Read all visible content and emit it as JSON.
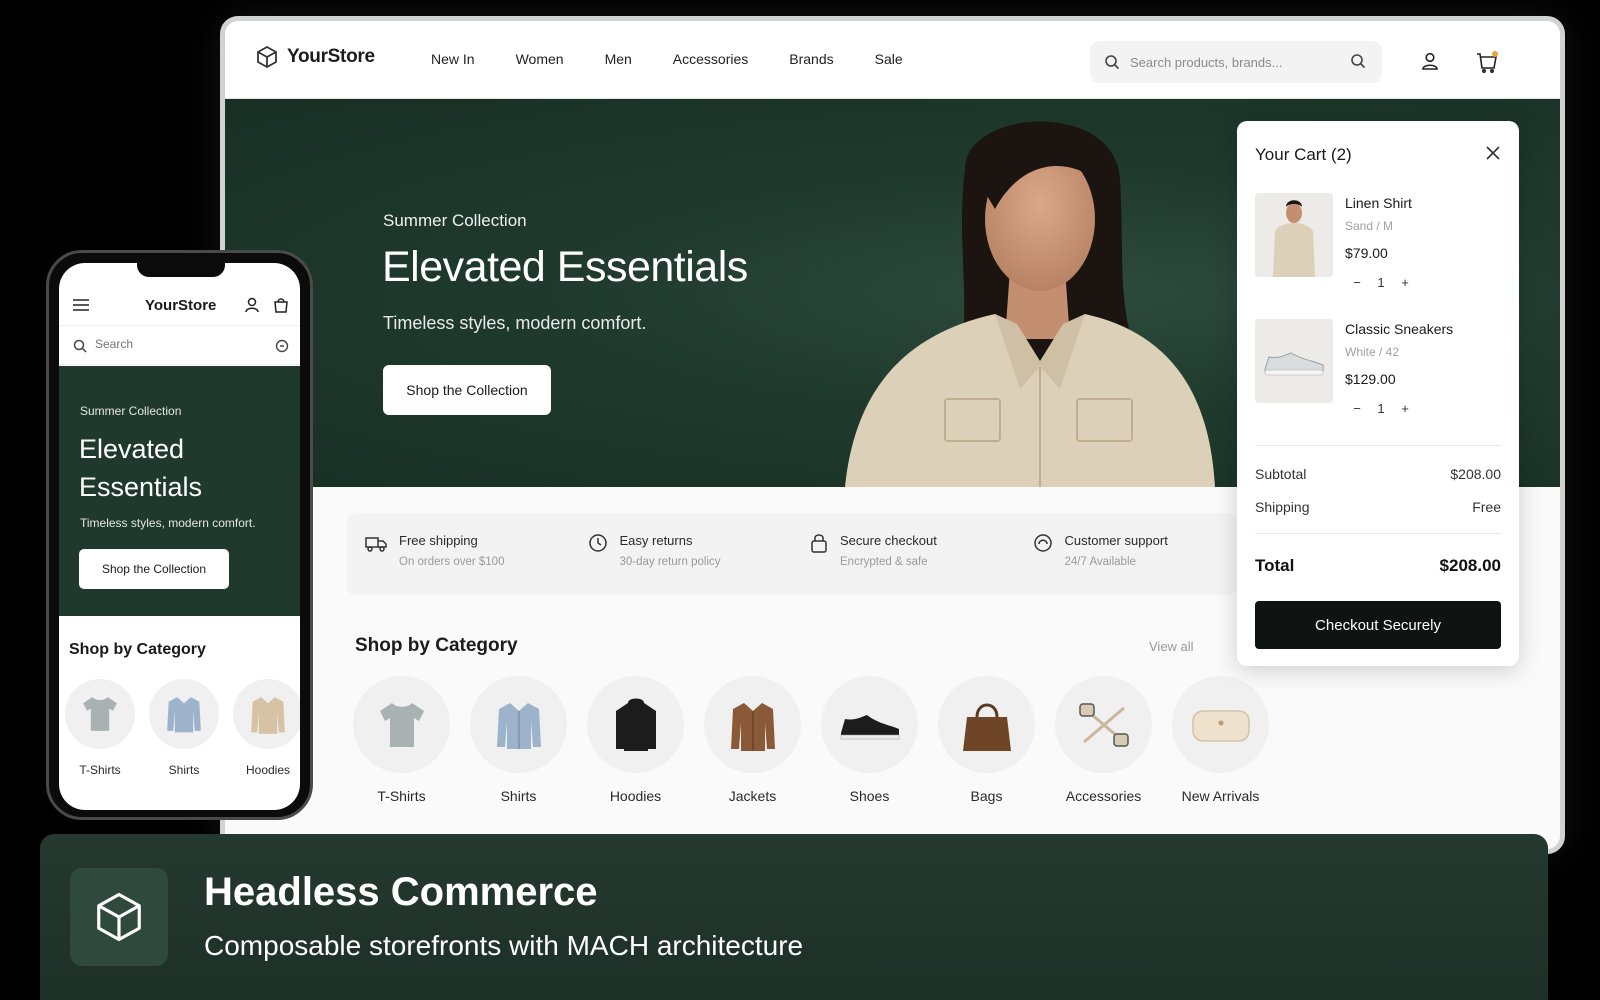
{
  "store": {
    "name": "YourStore"
  },
  "nav": {
    "items": [
      "New In",
      "Women",
      "Men",
      "Accessories",
      "Brands",
      "Sale"
    ],
    "search_placeholder": "Search products, brands..."
  },
  "hero": {
    "eyebrow": "Summer Collection",
    "title": "Elevated Essentials",
    "subtitle": "Timeless styles, modern comfort.",
    "cta": "Shop the Collection"
  },
  "features": [
    {
      "title": "Free shipping",
      "sub": "On orders over $100",
      "icon": "truck-icon"
    },
    {
      "title": "Easy returns",
      "sub": "30-day return policy",
      "icon": "return-icon"
    },
    {
      "title": "Secure checkout",
      "sub": "Encrypted & safe",
      "icon": "lock-icon"
    },
    {
      "title": "Customer support",
      "sub": "24/7 Available",
      "icon": "support-icon"
    }
  ],
  "categories": {
    "title": "Shop by Category",
    "view_all": "View all",
    "items": [
      "T-Shirts",
      "Shirts",
      "Hoodies",
      "Jackets",
      "Shoes",
      "Bags",
      "Accessories",
      "New Arrivals"
    ]
  },
  "cart": {
    "title": "Your Cart (2)",
    "items": [
      {
        "name": "Linen Shirt",
        "variant": "Sand / M",
        "price": "$79.00",
        "qty": "1"
      },
      {
        "name": "Classic Sneakers",
        "variant": "White / 42",
        "price": "$129.00",
        "qty": "1"
      }
    ],
    "subtotal_label": "Subtotal",
    "subtotal": "$208.00",
    "shipping_label": "Shipping",
    "shipping": "Free",
    "total_label": "Total",
    "total": "$208.00",
    "checkout": "Checkout Securely"
  },
  "mobile": {
    "search_placeholder": "Search",
    "hero_eyebrow": "Summer Collection",
    "hero_title": "Elevated Essentials",
    "hero_sub": "Timeless styles, modern comfort.",
    "cta": "Shop the Collection",
    "cat_title": "Shop by Category",
    "cats": [
      "T-Shirts",
      "Shirts",
      "Hoodies"
    ]
  },
  "banner": {
    "title": "Headless Commerce",
    "subtitle": "Composable storefronts with MACH architecture"
  },
  "colors": {
    "brand_green": "#1f3a2d",
    "checkout": "#0f1412"
  }
}
